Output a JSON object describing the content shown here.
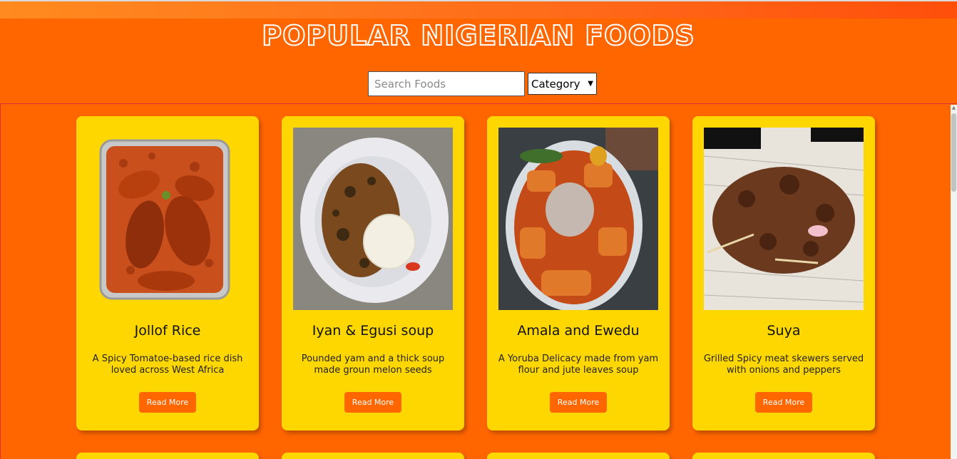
{
  "header": {
    "title": "POPULAR NIGERIAN FOODS",
    "search_placeholder": "Search Foods",
    "category_label": "Category"
  },
  "foods": [
    {
      "name": "Jollof Rice",
      "description": "A Spicy Tomatoe-based rice dish loved across West Africa",
      "button": "Read More",
      "image": "jollof-rice-tray"
    },
    {
      "name": "Iyan & Egusi soup",
      "description": "Pounded yam and a thick soup made groun melon seeds",
      "button": "Read More",
      "image": "pounded-yam-egusi-bowl"
    },
    {
      "name": "Amala and Ewedu",
      "description": "A Yoruba Delicacy made from yam flour and jute leaves soup",
      "button": "Read More",
      "image": "amala-ewedu-bowl"
    },
    {
      "name": "Suya",
      "description": "Grilled Spicy meat skewers served with onions and peppers",
      "button": "Read More",
      "image": "suya-newspaper"
    }
  ],
  "colors": {
    "page_bg": "#ff6600",
    "card_bg": "#ffd700",
    "button_bg": "#ff6600"
  }
}
